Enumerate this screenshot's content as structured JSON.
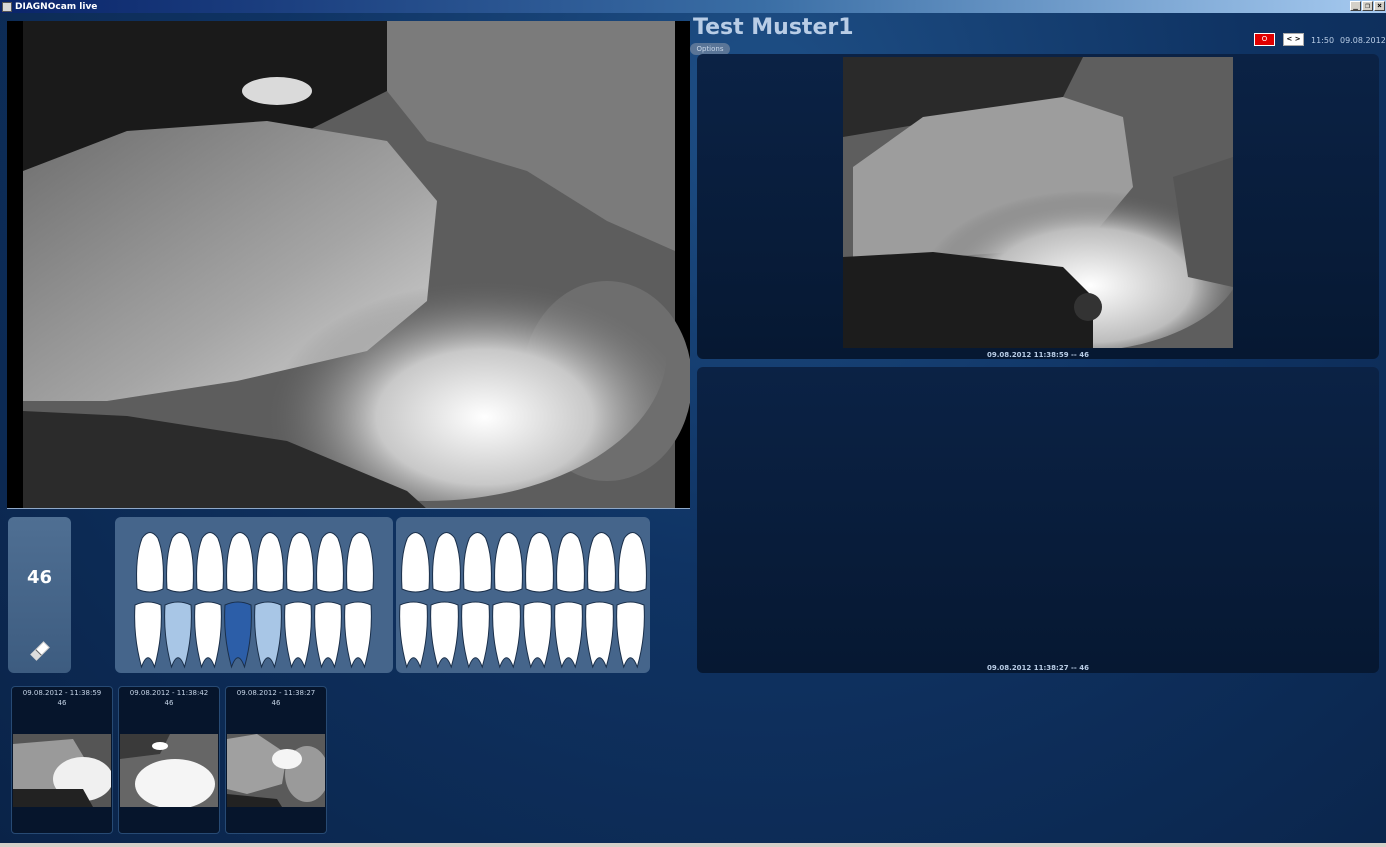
{
  "window": {
    "title": "DIAGNOcam live",
    "controls": [
      "_",
      "❐",
      "×"
    ]
  },
  "patient": {
    "name": "Test Muster1",
    "options_label": "Options"
  },
  "toolbar": {
    "record_label": "O",
    "nav_label": "< >",
    "time": "11:50",
    "date": "09.08.2012"
  },
  "tooth": {
    "selected_number": "46",
    "tool_icon": "eraser-icon"
  },
  "captures": {
    "top_caption": "09.08.2012 11:38:59 -- 46",
    "bottom_caption": "09.08.2012 11:38:27 -- 46"
  },
  "thumbnails": [
    {
      "date": "09.08.2012 - 11:38:59",
      "tooth": "46"
    },
    {
      "date": "09.08.2012 - 11:38:42",
      "tooth": "46"
    },
    {
      "date": "09.08.2012 - 11:38:27",
      "tooth": "46"
    }
  ],
  "colors": {
    "background": "#0f3363",
    "panel": "#45658b",
    "selected_tooth": "#2c5ea8",
    "highlight_tooth": "#a8c6e6",
    "record": "#e00000"
  }
}
